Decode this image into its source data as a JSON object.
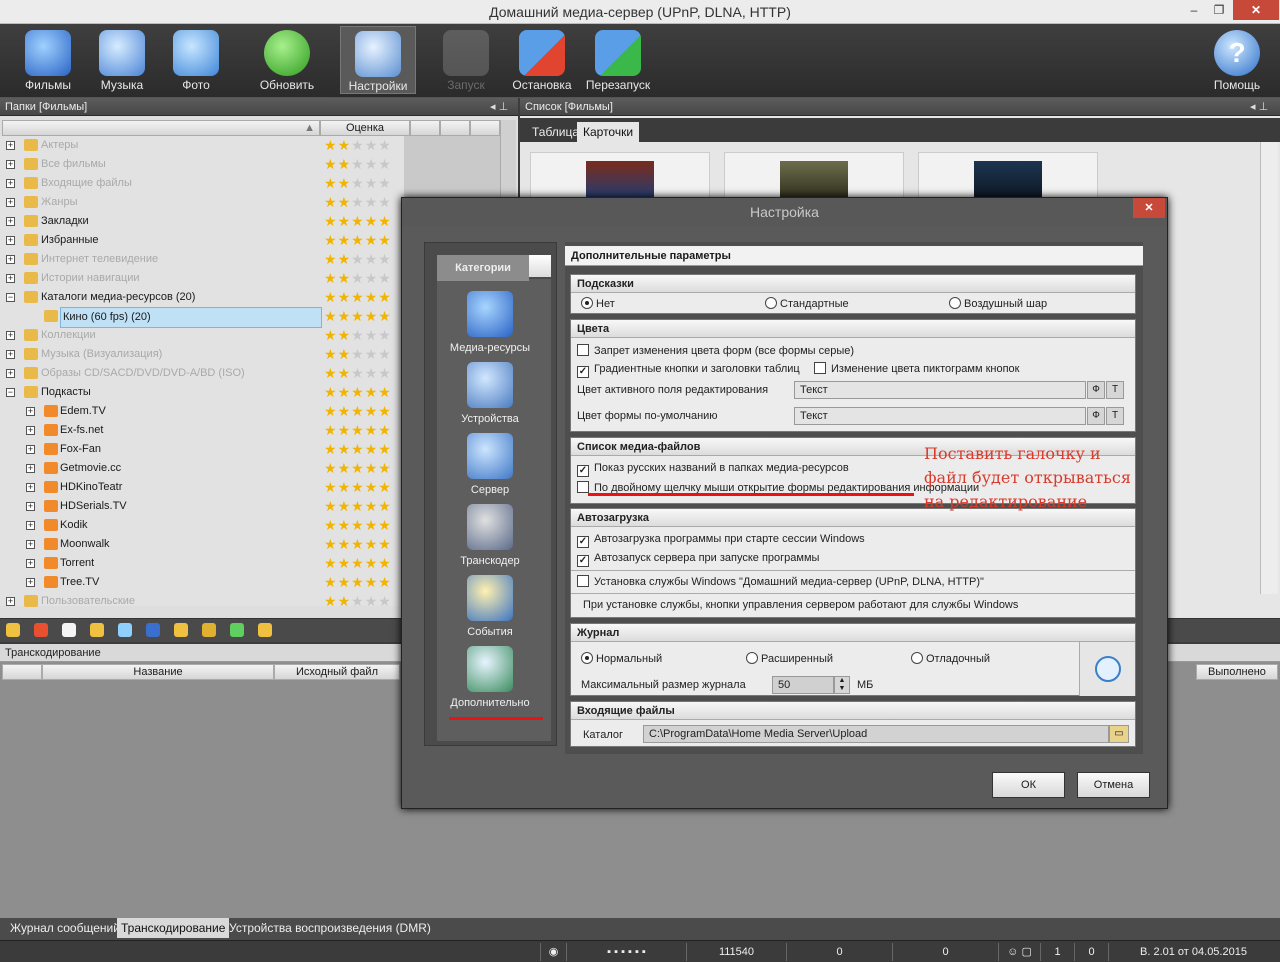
{
  "window": {
    "title": "Домашний медиа-сервер (UPnP, DLNA, HTTP)"
  },
  "toolbar": {
    "films": "Фильмы",
    "music": "Музыка",
    "photo": "Фото",
    "refresh": "Обновить",
    "settings": "Настройки",
    "start": "Запуск",
    "stop": "Остановка",
    "restart": "Перезапуск",
    "help": "Помощь"
  },
  "left": {
    "header": "Папки [Фильмы]",
    "col_rating": "Оценка",
    "tree": [
      {
        "label": "Актеры",
        "faded": true,
        "stars": 2
      },
      {
        "label": "Все фильмы",
        "faded": true,
        "stars": 2
      },
      {
        "label": "Входящие файлы",
        "faded": true,
        "stars": 2
      },
      {
        "label": "Жанры",
        "faded": true,
        "stars": 2
      },
      {
        "label": "Закладки",
        "faded": false,
        "stars": 5
      },
      {
        "label": "Избранные",
        "faded": false,
        "stars": 5
      },
      {
        "label": "Интернет телевидение",
        "faded": true,
        "stars": 2
      },
      {
        "label": "Истории навигации",
        "faded": true,
        "stars": 2
      },
      {
        "label": "Каталоги медиа-ресурсов (20)",
        "faded": false,
        "stars": 5
      },
      {
        "label": "Кино (60 fps) (20)",
        "faded": false,
        "stars": 5
      },
      {
        "label": "Коллекции",
        "faded": true,
        "stars": 2
      },
      {
        "label": "Музыка (Визуализация)",
        "faded": true,
        "stars": 2
      },
      {
        "label": "Образы CD/SACD/DVD/DVD-A/BD (ISO)",
        "faded": true,
        "stars": 2
      },
      {
        "label": "Подкасты",
        "faded": false,
        "stars": 5
      },
      {
        "label": "Edem.TV",
        "faded": false,
        "stars": 5
      },
      {
        "label": "Ex-fs.net",
        "faded": false,
        "stars": 5
      },
      {
        "label": "Fox-Fan",
        "faded": false,
        "stars": 5
      },
      {
        "label": "Getmovie.cc",
        "faded": false,
        "stars": 5
      },
      {
        "label": "HDKinoTeatr",
        "faded": false,
        "stars": 5
      },
      {
        "label": "HDSerials.TV",
        "faded": false,
        "stars": 5
      },
      {
        "label": "Kodik",
        "faded": false,
        "stars": 5
      },
      {
        "label": "Moonwalk",
        "faded": false,
        "stars": 5
      },
      {
        "label": "Torrent",
        "faded": false,
        "stars": 5
      },
      {
        "label": "Tree.TV",
        "faded": false,
        "stars": 5
      },
      {
        "label": "Пользовательские",
        "faded": true,
        "stars": 2
      }
    ]
  },
  "right": {
    "header": "Список [Фильмы]",
    "tab_table": "Таблица",
    "tab_cards": "Карточки"
  },
  "transcode": {
    "header": "Транскодирование",
    "col_name": "Название",
    "col_source": "Исходный файл",
    "col_done": "Выполнено"
  },
  "bottom_tabs": {
    "log": "Журнал сообщений",
    "transcode": "Транскодирование",
    "dmr": "Устройства воспроизведения (DMR)"
  },
  "status": {
    "count": "111540",
    "v1": "0",
    "v2": "0",
    "v3": "1",
    "v4": "0",
    "version": "В. 2.01 от 04.05.2015"
  },
  "dialog": {
    "title": "Настройка",
    "categories_header": "Категории",
    "cats": {
      "media": "Медиа-ресурсы",
      "devices": "Устройства",
      "server": "Сервер",
      "transcoder": "Транскодер",
      "events": "События",
      "extra": "Дополнительно"
    },
    "section_title": "Дополнительные параметры",
    "hints": {
      "title": "Подсказки",
      "none": "Нет",
      "standard": "Стандартные",
      "balloon": "Воздушный шар"
    },
    "colors": {
      "title": "Цвета",
      "forbid": "Запрет изменения цвета форм (все формы серые)",
      "gradient": "Градиентные кнопки и заголовки таблиц",
      "icon_color": "Изменение цвета пиктограмм кнопок",
      "active_label": "Цвет активного поля редактирования",
      "active_value": "Текст",
      "default_label": "Цвет формы по-умолчанию",
      "default_value": "Текст",
      "btn_f": "Ф",
      "btn_t": "Т"
    },
    "medialist": {
      "title": "Список медиа-файлов",
      "russian": "Показ русских названий в папках медиа-ресурсов",
      "dblclick": "По двойному щелчку мыши открытие формы редактирования информации"
    },
    "autoload": {
      "title": "Автозагрузка",
      "autostart": "Автозагрузка программы при старте сессии Windows",
      "autoserver": "Автозапуск сервера при запуске программы",
      "service": "Установка службы Windows \"Домашний медиа-сервер (UPnP, DLNA, HTTP)\"",
      "service_note": "При установке службы, кнопки управления сервером работают для службы Windows"
    },
    "journal": {
      "title": "Журнал",
      "normal": "Нормальный",
      "extended": "Расширенный",
      "debug": "Отладочный",
      "size_label": "Максимальный размер  журнала",
      "size_value": "50",
      "unit": "МБ"
    },
    "incoming": {
      "title": "Входящие файлы",
      "catalog_label": "Каталог",
      "catalog_value": "C:\\ProgramData\\Home Media Server\\Upload"
    },
    "ok": "ОК",
    "cancel": "Отмена"
  },
  "annotation": "Поставить галочку и файл будет открываться на редактирование",
  "colors": {
    "accent_red": "#e11111",
    "annotation_red": "#d83a2c",
    "star": "#f1b400"
  }
}
